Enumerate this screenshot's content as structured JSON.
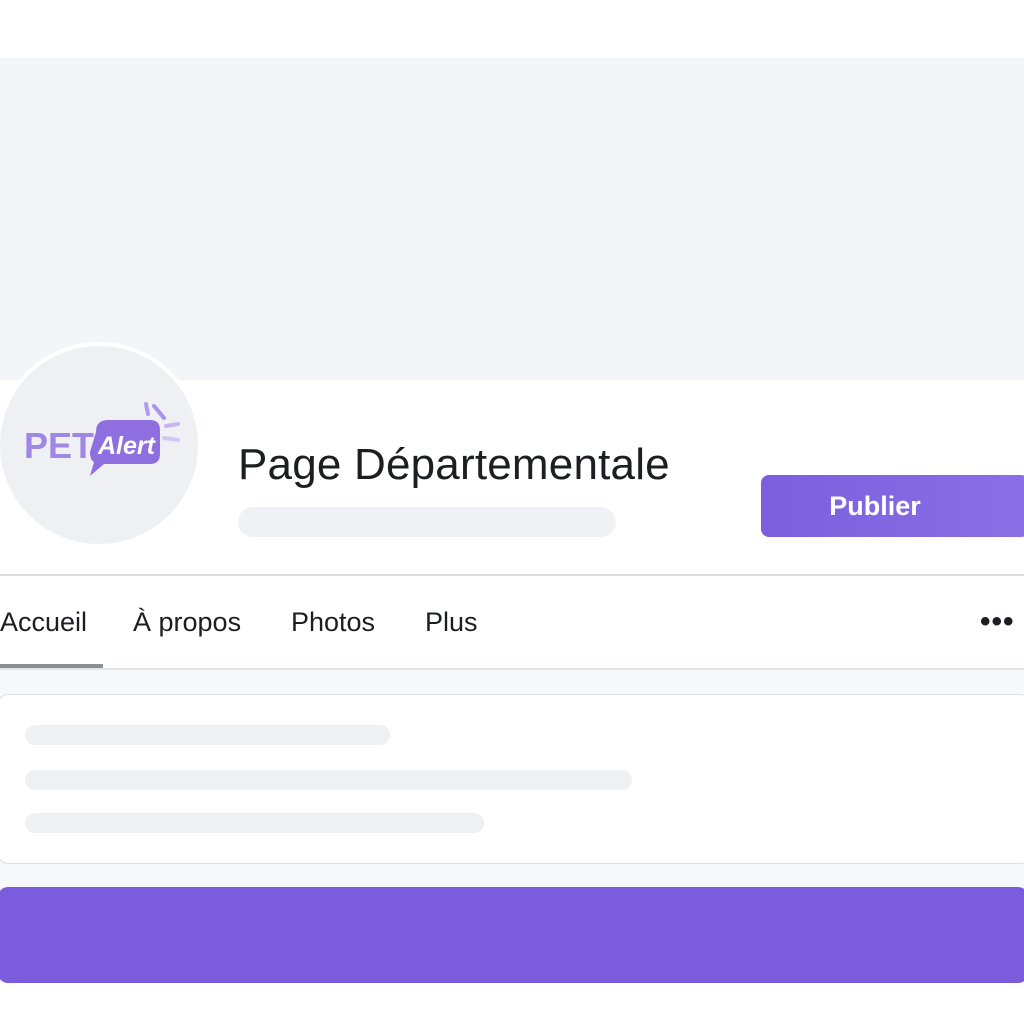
{
  "brand": {
    "logo_text_pet": "PET",
    "logo_text_alert": "Alert",
    "accent_color": "#7a5cdd",
    "logo_pet_color": "#9f87e3"
  },
  "page": {
    "title": "Page Départementale"
  },
  "actions": {
    "publish_label": "Publier"
  },
  "tabs": [
    {
      "label": "Accueil",
      "active": true
    },
    {
      "label": "À propos",
      "active": false
    },
    {
      "label": "Photos",
      "active": false
    },
    {
      "label": "Plus",
      "active": false
    }
  ],
  "more_menu_icon": "more-horizontal-icon",
  "more_menu_glyph": "•••"
}
